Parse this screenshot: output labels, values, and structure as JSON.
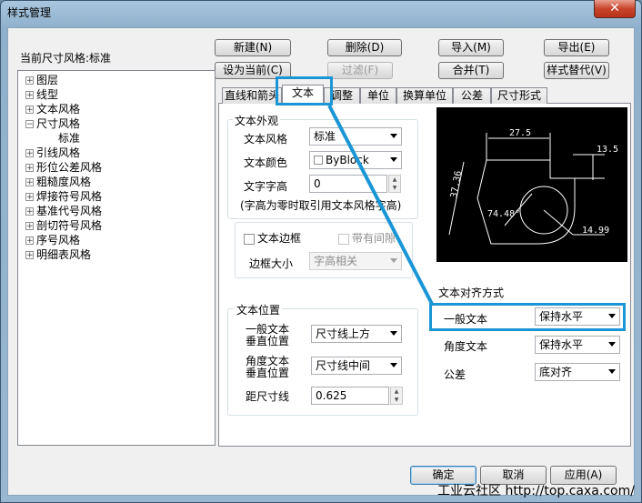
{
  "window": {
    "title": "样式管理",
    "close": "✕"
  },
  "header": {
    "current_style_label": "当前尺寸风格:标准"
  },
  "toolbar": {
    "new": "新建(N)",
    "delete": "删除(D)",
    "import": "导入(M)",
    "export": "导出(E)",
    "set_current": "设为当前(C)",
    "filter": "过滤(F)",
    "merge": "合并(T)",
    "replace": "样式替代(V)"
  },
  "tree": {
    "items": [
      {
        "label": "图层",
        "exp": "+"
      },
      {
        "label": "线型",
        "exp": "+"
      },
      {
        "label": "文本风格",
        "exp": "+"
      },
      {
        "label": "尺寸风格",
        "exp": "−"
      },
      {
        "label": "标准",
        "exp": ""
      },
      {
        "label": "引线风格",
        "exp": "+"
      },
      {
        "label": "形位公差风格",
        "exp": "+"
      },
      {
        "label": "粗糙度风格",
        "exp": "+"
      },
      {
        "label": "焊接符号风格",
        "exp": "+"
      },
      {
        "label": "基准代号风格",
        "exp": "+"
      },
      {
        "label": "剖切符号风格",
        "exp": "+"
      },
      {
        "label": "序号风格",
        "exp": "+"
      },
      {
        "label": "明细表风格",
        "exp": "+"
      }
    ]
  },
  "tabs": [
    "直线和箭头",
    "文本",
    "调整",
    "单位",
    "换算单位",
    "公差",
    "尺寸形式"
  ],
  "text_appearance": {
    "group": "文本外观",
    "style_label": "文本风格",
    "style_value": "标准",
    "color_label": "文本颜色",
    "color_value": "ByBlock",
    "height_label": "文字字高",
    "height_value": "0",
    "note": "(字高为零时取引用文本风格字高)"
  },
  "frame": {
    "checkbox_label": "文本边框",
    "gap_label": "带有间隙",
    "size_label": "边框大小",
    "size_value": "字高相关"
  },
  "text_position": {
    "group": "文本位置",
    "general_label_1": "一般文本",
    "general_label_2": "垂直位置",
    "general_value": "尺寸线上方",
    "angle_label_1": "角度文本",
    "angle_label_2": "垂直位置",
    "angle_value": "尺寸线中间",
    "offset_label": "距尺寸线",
    "offset_value": "0.625"
  },
  "alignment": {
    "group": "文本对齐方式",
    "general_label": "一般文本",
    "general_value": "保持水平",
    "angle_label": "角度文本",
    "angle_value": "保持水平",
    "tolerance_label": "公差",
    "tolerance_value": "底对齐"
  },
  "preview": {
    "dim_top": "27.5",
    "dim_right": "13.5",
    "dim_left": "37.36",
    "dim_angle": "74.48°",
    "dim_radius": "14.99"
  },
  "footer": {
    "ok": "确定",
    "cancel": "取消",
    "apply": "应用(A)"
  },
  "watermark": "工业云社区 http://top.caxa.com/",
  "colors": {
    "highlight": "#1a96d6",
    "preview_bg": "#000000",
    "preview_stroke": "#ffffff"
  }
}
